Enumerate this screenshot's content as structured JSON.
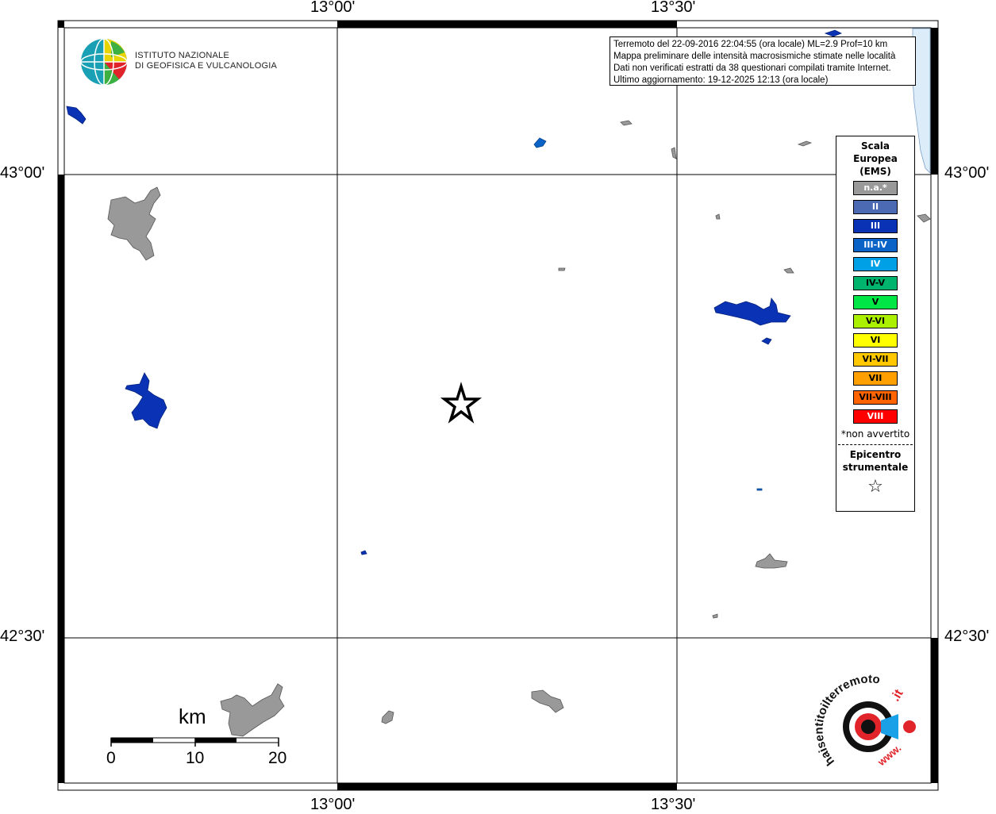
{
  "info_box": {
    "line1": "Terremoto del 22-09-2016 22:04:55 (ora locale) ML=2.9 Prof=10 km",
    "line2": "Mappa preliminare delle intensità macrosismiche stimate nelle località",
    "line3": "Dati non verificati estratti da 38 questionari compilati tramite Internet.",
    "line4": "Ultimo aggiornamento: 19-12-2025 12:13 (ora locale)"
  },
  "axes": {
    "top_labels": [
      "13°00'",
      "13°30'"
    ],
    "bottom_labels": [
      "13°00'",
      "13°30'"
    ],
    "left_labels": [
      "43°00'",
      "42°30'"
    ],
    "right_labels": [
      "43°00'",
      "42°30'"
    ]
  },
  "logo": {
    "line1": "ISTITUTO NAZIONALE",
    "line2": "DI GEOFISICA E VULCANOLOGIA"
  },
  "legend": {
    "title1": "Scala",
    "title2": "Europea",
    "title3": "(EMS)",
    "items": [
      {
        "label": "n.a.*",
        "color": "#999999",
        "text_color": "#ffffff"
      },
      {
        "label": "II",
        "color": "#4c69b4",
        "text_color": "#ffffff"
      },
      {
        "label": "III",
        "color": "#0a32b4",
        "text_color": "#ffffff"
      },
      {
        "label": "III-IV",
        "color": "#0a64c8",
        "text_color": "#ffffff"
      },
      {
        "label": "IV",
        "color": "#00a0e6",
        "text_color": "#ffffff"
      },
      {
        "label": "IV-V",
        "color": "#00b46e",
        "text_color": "#000000"
      },
      {
        "label": "V",
        "color": "#00e646",
        "text_color": "#000000"
      },
      {
        "label": "V-VI",
        "color": "#aaf000",
        "text_color": "#000000"
      },
      {
        "label": "VI",
        "color": "#ffff00",
        "text_color": "#000000"
      },
      {
        "label": "VI-VII",
        "color": "#ffc800",
        "text_color": "#000000"
      },
      {
        "label": "VII",
        "color": "#ffa000",
        "text_color": "#000000"
      },
      {
        "label": "VII-VIII",
        "color": "#ff6400",
        "text_color": "#000000"
      },
      {
        "label": "VIII",
        "color": "#ff0000",
        "text_color": "#ffffff"
      }
    ],
    "note": "*non avvertito",
    "epicenter1": "Epicentro",
    "epicenter2": "strumentale",
    "epicenter_symbol": "☆"
  },
  "scale_bar": {
    "unit": "km",
    "ticks": [
      "0",
      "10",
      "20"
    ]
  },
  "watermark": {
    "text1": "haisentitoilterremoto",
    "text2": ".it",
    "text3": "www."
  },
  "colors": {
    "na": "#999999",
    "iii": "#0a32b4",
    "iii_iv": "#0a64c8",
    "iv": "#00a0e6",
    "sea": "#dcecf8"
  }
}
